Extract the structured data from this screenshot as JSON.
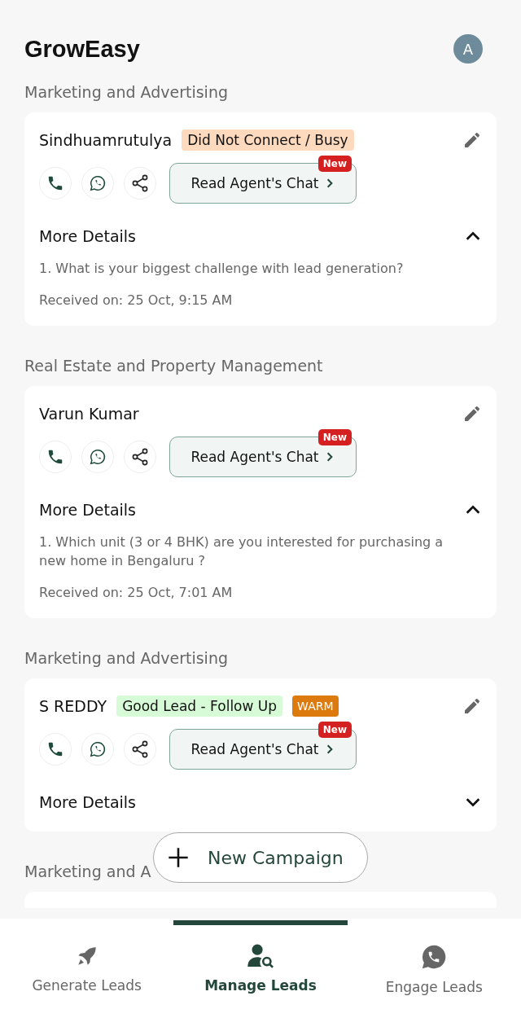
{
  "app_bar": {
    "title": "GrowEasy",
    "avatar": "A"
  },
  "leads": [
    {
      "category": "Marketing and Advertising",
      "name": "Sindhuamrutulya",
      "tags": [
        {
          "text": "Did Not Connect / Busy",
          "kind": "soft",
          "color": "#fdd9bd"
        }
      ],
      "chat_button": "Read Agent's Chat",
      "chat_badge": "New",
      "details_label": "More Details",
      "expanded": true,
      "questions": [
        "1. What is your biggest challenge with lead generation?"
      ],
      "received": "Received on: 25 Oct, 9:15 AM"
    },
    {
      "category": "Real Estate and Property Management",
      "name": "Varun Kumar",
      "chat_button": "Read Agent's Chat",
      "chat_badge": "New",
      "details_label": "More Details",
      "expanded": true,
      "questions": [
        "1. Which unit (3 or 4 BHK) are you interested for purchasing a new home in Bengaluru ?"
      ],
      "received": "Received on: 25 Oct, 7:01 AM"
    },
    {
      "category": "Marketing and Advertising",
      "name": "S REDDY",
      "tags": [
        {
          "text": "Good Lead - Follow Up",
          "kind": "soft",
          "color": "#d7fbd7"
        },
        {
          "text": "WARM",
          "kind": "solid",
          "color": "#dd7a0e"
        }
      ],
      "chat_button": "Read Agent's Chat",
      "chat_badge": "New",
      "details_label": "More Details",
      "expanded": false
    },
    {
      "category": "Marketing and A"
    }
  ],
  "fab": {
    "label": "New Campaign"
  },
  "bottom_nav": [
    {
      "label": "Generate Leads",
      "selected": false
    },
    {
      "label": "Manage Leads",
      "selected": true
    },
    {
      "label": "Engage Leads",
      "selected": false
    }
  ]
}
